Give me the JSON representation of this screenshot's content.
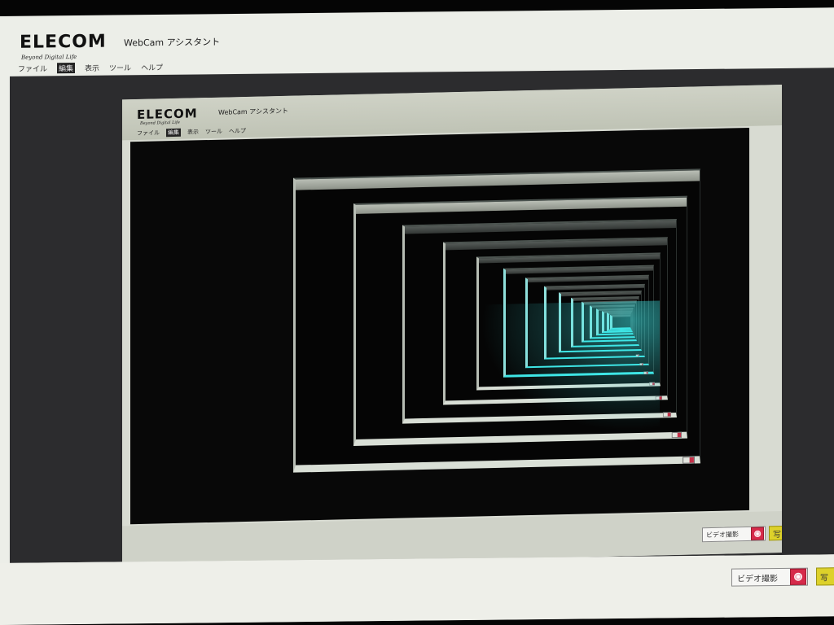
{
  "app": {
    "logo": "ELECOM",
    "tagline": "Beyond Digital Life",
    "title": "WebCam アシスタント"
  },
  "menu": {
    "items": [
      {
        "label": "ファイル",
        "active": false
      },
      {
        "label": "編集",
        "active": true
      },
      {
        "label": "表示",
        "active": false
      },
      {
        "label": "ツール",
        "active": false
      },
      {
        "label": "ヘルプ",
        "active": false
      }
    ]
  },
  "controls": {
    "record_label": "ビデオ撮影",
    "record_icon": "record-icon",
    "snapshot_label": "写"
  },
  "colors": {
    "window_bg": "#eceee8",
    "viewport_bg": "#2c2c2e",
    "record_red": "#d62a4a",
    "snapshot_yellow": "#ddd12a",
    "feedback_cyan": "#3ee6e6"
  }
}
